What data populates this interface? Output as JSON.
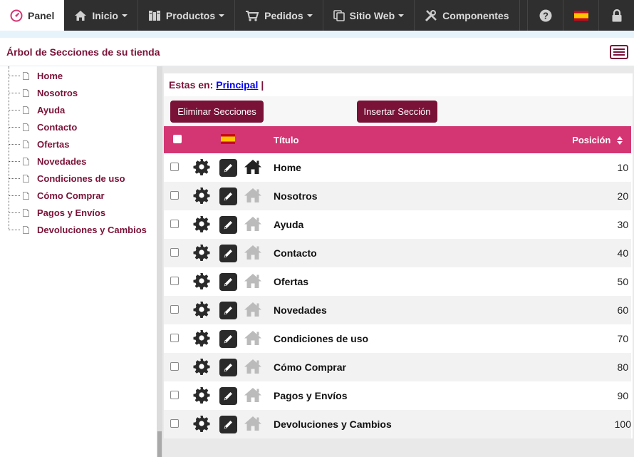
{
  "nav": {
    "items": [
      {
        "label": "Panel",
        "icon": "dashboard-icon",
        "active": true
      },
      {
        "label": "Inicio",
        "icon": "home-icon",
        "dropdown": true
      },
      {
        "label": "Productos",
        "icon": "books-icon",
        "dropdown": true
      },
      {
        "label": "Pedidos",
        "icon": "cart-icon",
        "dropdown": true
      },
      {
        "label": "Sitio Web",
        "icon": "copy-icon",
        "dropdown": true
      },
      {
        "label": "Componentes",
        "icon": "tools-icon"
      }
    ],
    "right": [
      "help-icon",
      "spain-flag-icon",
      "lock-icon"
    ]
  },
  "page": {
    "title": "Árbol de Secciones de su tienda"
  },
  "tree": {
    "items": [
      "Home",
      "Nosotros",
      "Ayuda",
      "Contacto",
      "Ofertas",
      "Novedades",
      "Condiciones de uso",
      "Cómo Comprar",
      "Pagos y Envíos",
      "Devoluciones y Cambios"
    ]
  },
  "breadcrumb": {
    "prefix": "Estas en:",
    "link": "Principal",
    "separator": "|"
  },
  "actions": {
    "delete_label": "Eliminar Secciones",
    "insert_label": "Insertar Sección"
  },
  "table": {
    "headers": {
      "title": "Título",
      "position": "Posición"
    },
    "rows": [
      {
        "title": "Home",
        "position": "10",
        "is_home": true
      },
      {
        "title": "Nosotros",
        "position": "20",
        "is_home": false
      },
      {
        "title": "Ayuda",
        "position": "30",
        "is_home": false
      },
      {
        "title": "Contacto",
        "position": "40",
        "is_home": false
      },
      {
        "title": "Ofertas",
        "position": "50",
        "is_home": false
      },
      {
        "title": "Novedades",
        "position": "60",
        "is_home": false
      },
      {
        "title": "Condiciones de uso",
        "position": "70",
        "is_home": false
      },
      {
        "title": "Cómo Comprar",
        "position": "80",
        "is_home": false
      },
      {
        "title": "Pagos y Envíos",
        "position": "90",
        "is_home": false
      },
      {
        "title": "Devoluciones y Cambios",
        "position": "100",
        "is_home": false
      }
    ]
  },
  "colors": {
    "brand": "#7a1238",
    "header_bg": "#d33673",
    "nav_bg": "#2f2f2f",
    "home_active": "#222222",
    "home_inactive": "#bbbbbb"
  }
}
